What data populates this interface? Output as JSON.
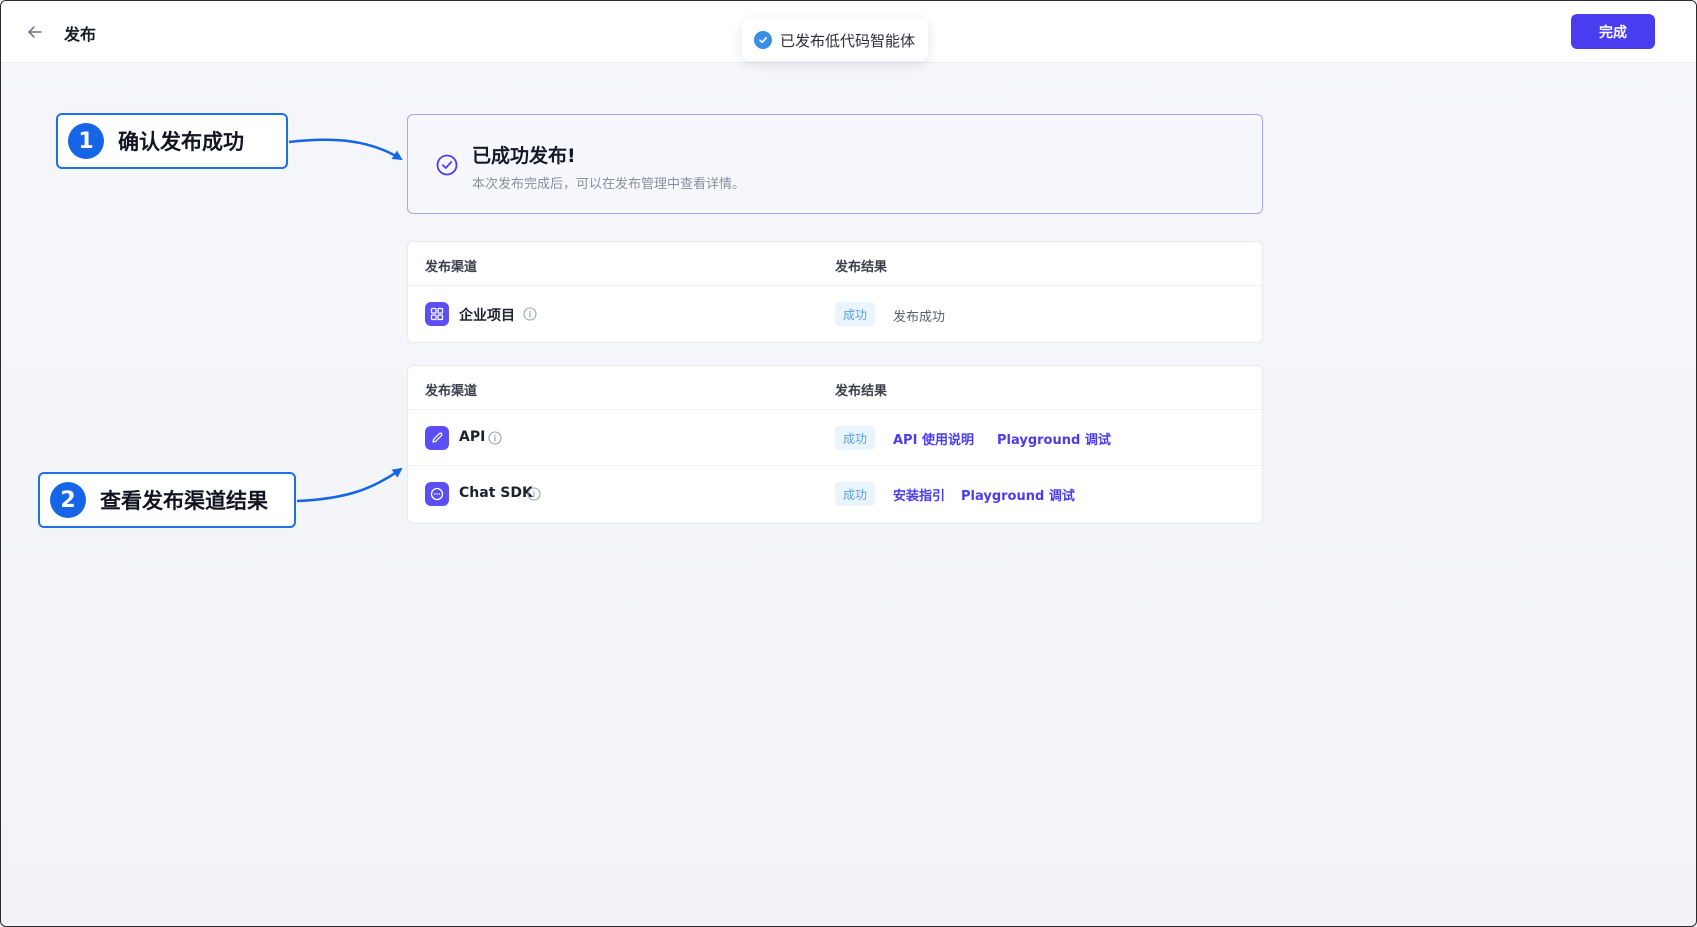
{
  "header": {
    "title": "发布",
    "done_label": "完成"
  },
  "toast": {
    "text": "已发布低代码智能体"
  },
  "callouts": [
    {
      "number": "1",
      "text": "确认发布成功"
    },
    {
      "number": "2",
      "text": "查看发布渠道结果"
    }
  ],
  "banner": {
    "title": "已成功发布!",
    "description": "本次发布完成后，可以在发布管理中查看详情。"
  },
  "tables": [
    {
      "headers": {
        "channel": "发布渠道",
        "result": "发布结果"
      },
      "rows": [
        {
          "icon": "grid-icon",
          "name": "企业项目",
          "status": "成功",
          "result_text": "发布成功"
        }
      ]
    },
    {
      "headers": {
        "channel": "发布渠道",
        "result": "发布结果"
      },
      "rows": [
        {
          "icon": "pencil-icon",
          "name": "API",
          "status": "成功",
          "links": [
            "API 使用说明",
            "Playground 调试"
          ]
        },
        {
          "icon": "chat-icon",
          "name": "Chat SDK",
          "status": "成功",
          "links": [
            "安装指引",
            "Playground 调试"
          ]
        }
      ]
    }
  ],
  "colors": {
    "primary": "#4a3df0",
    "callout_blue": "#1565e6",
    "success_tag_bg": "#eaf4fd",
    "success_tag_text": "#5aa0de",
    "toast_icon": "#3a8ee6"
  }
}
